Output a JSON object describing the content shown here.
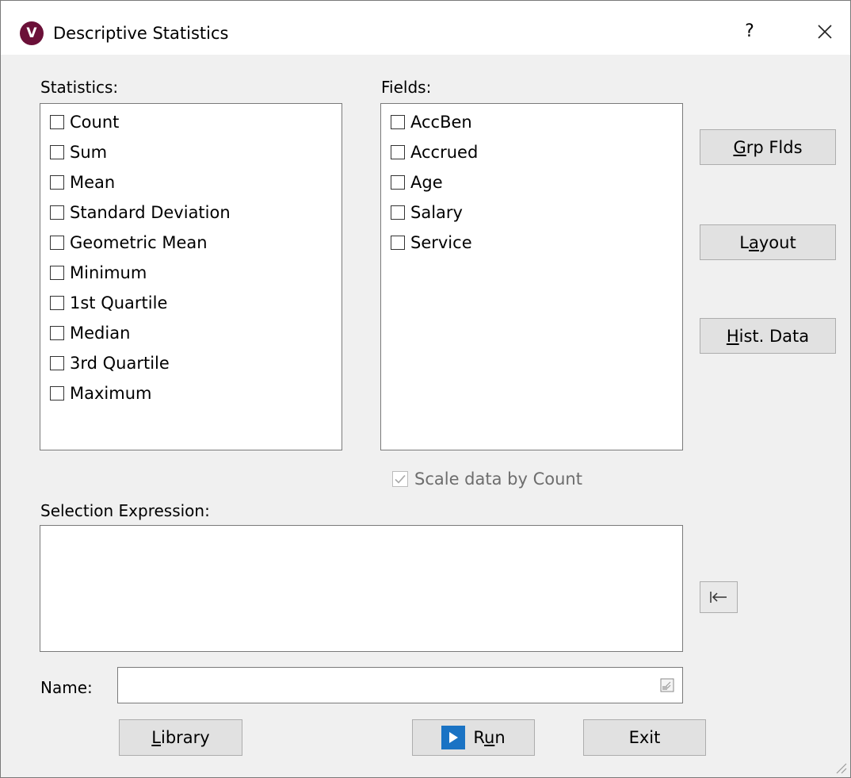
{
  "window": {
    "title": "Descriptive Statistics",
    "icon_letter": "V",
    "help_label": "?",
    "close_label": "✕"
  },
  "statistics": {
    "label": "Statistics:",
    "items": [
      "Count",
      "Sum",
      "Mean",
      "Standard Deviation",
      "Geometric Mean",
      "Minimum",
      "1st Quartile",
      "Median",
      "3rd Quartile",
      "Maximum"
    ]
  },
  "fields": {
    "label": "Fields:",
    "items": [
      "AccBen",
      "Accrued",
      "Age",
      "Salary",
      "Service"
    ]
  },
  "side_buttons": {
    "grp_flds": {
      "accel": "G",
      "rest": "rp Flds"
    },
    "layout": {
      "pre": "L",
      "accel": "a",
      "rest": "yout"
    },
    "hist_data": {
      "accel": "H",
      "rest": "ist. Data"
    }
  },
  "scale_option": {
    "label": "Scale data by Count",
    "checked": true,
    "enabled": false
  },
  "selection": {
    "label": "Selection Expression:",
    "value": "",
    "insert_icon": "arrow-to-left-icon"
  },
  "name": {
    "label": "Name:",
    "value": ""
  },
  "bottom_buttons": {
    "library": {
      "accel": "L",
      "rest": "ibrary"
    },
    "run": {
      "pre": "R",
      "accel": "u",
      "rest": "n"
    },
    "exit": "Exit"
  },
  "colors": {
    "app_icon": "#6b1038",
    "run_icon": "#1a73c4",
    "dialog_bg": "#f0f0f0"
  }
}
